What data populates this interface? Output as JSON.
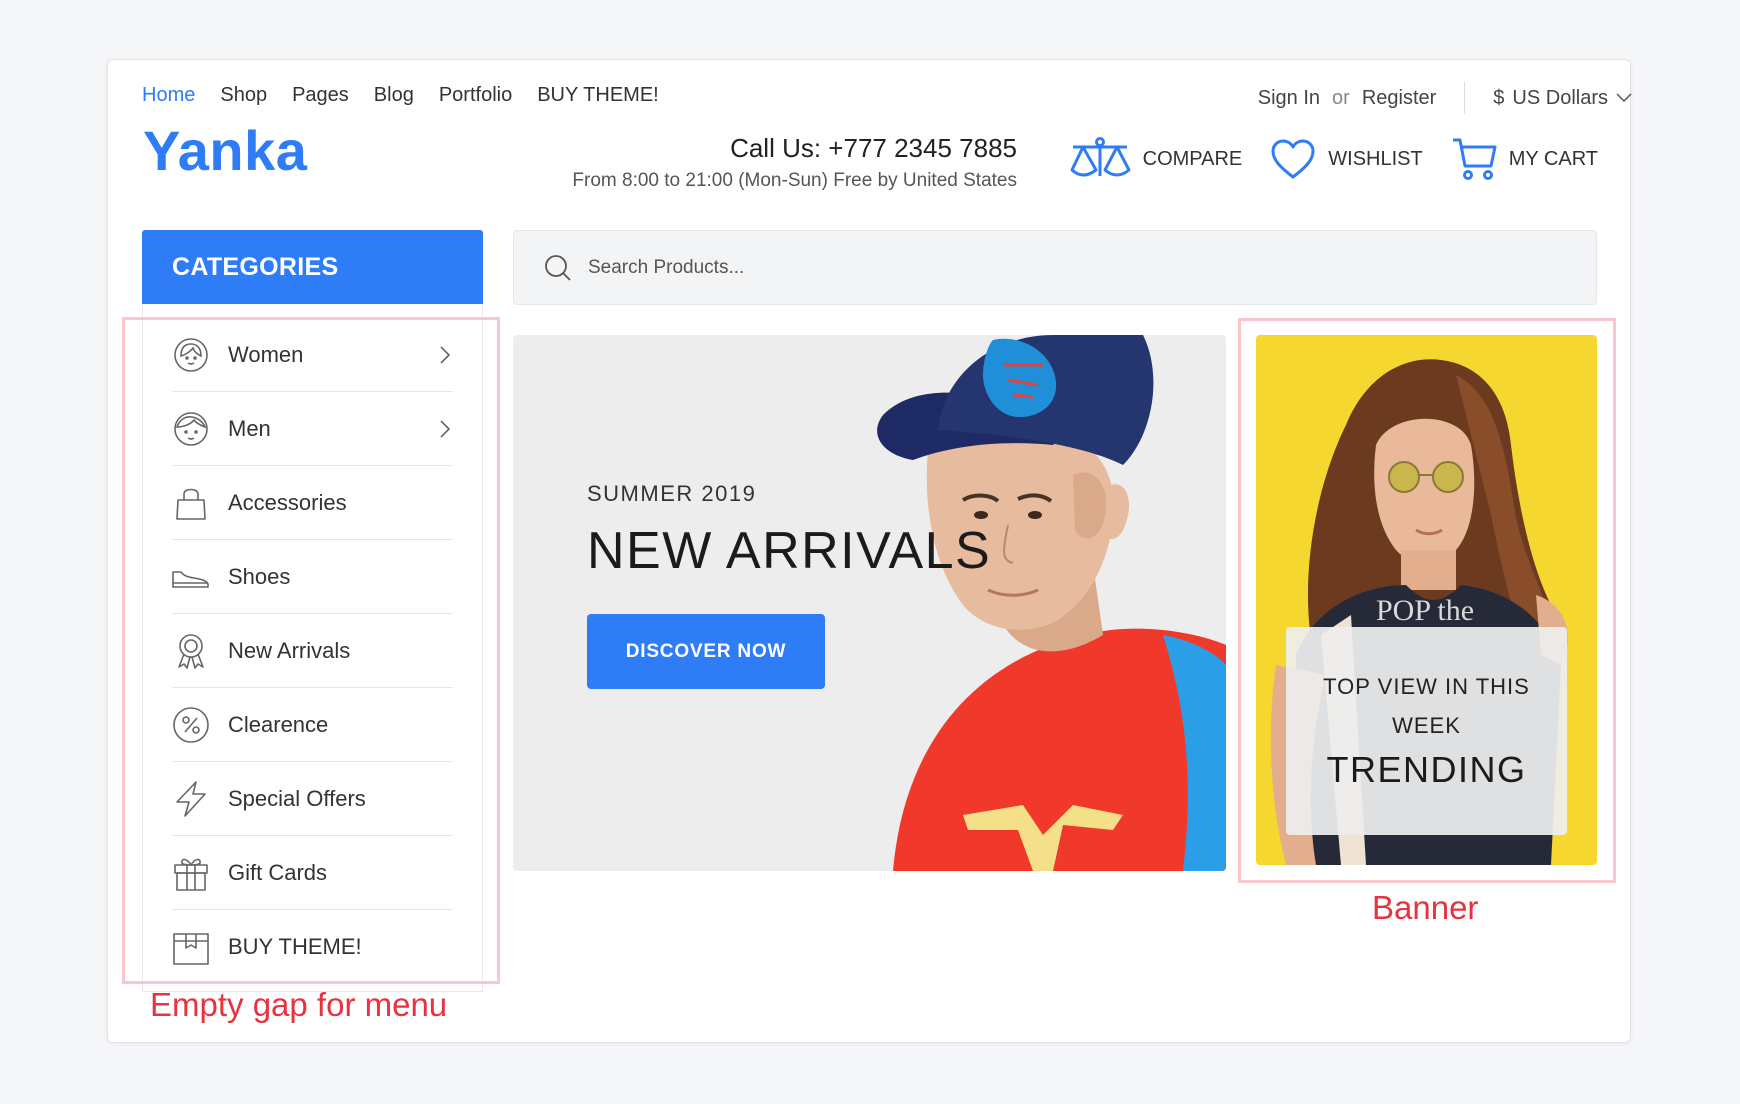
{
  "nav": {
    "items": [
      {
        "label": "Home",
        "active": true
      },
      {
        "label": "Shop"
      },
      {
        "label": "Pages"
      },
      {
        "label": "Blog"
      },
      {
        "label": "Portfolio"
      },
      {
        "label": "BUY THEME!"
      }
    ]
  },
  "account": {
    "sign_in": "Sign In",
    "or": "or",
    "register": "Register",
    "currency_symbol": "$",
    "currency": "US Dollars"
  },
  "brand": {
    "logo": "Yanka",
    "color": "#2e7cf6"
  },
  "contact": {
    "phone": "Call Us: +777 2345 7885",
    "hours": "From 8:00 to 21:00 (Mon-Sun) Free by United States"
  },
  "header_actions": {
    "compare": "COMPARE",
    "wishlist": "WISHLIST",
    "cart": "MY CART"
  },
  "categories": {
    "title": "CATEGORIES",
    "items": [
      {
        "label": "Women",
        "icon": "woman-face-icon",
        "has_submenu": true
      },
      {
        "label": "Men",
        "icon": "man-face-icon",
        "has_submenu": true
      },
      {
        "label": "Accessories",
        "icon": "bag-icon",
        "has_submenu": false
      },
      {
        "label": "Shoes",
        "icon": "shoe-icon",
        "has_submenu": false
      },
      {
        "label": "New Arrivals",
        "icon": "ribbon-badge-icon",
        "has_submenu": false
      },
      {
        "label": "Clearence",
        "icon": "percent-icon",
        "has_submenu": false
      },
      {
        "label": "Special Offers",
        "icon": "lightning-icon",
        "has_submenu": false
      },
      {
        "label": "Gift Cards",
        "icon": "gift-icon",
        "has_submenu": false
      },
      {
        "label": "BUY THEME!",
        "icon": "box-icon",
        "has_submenu": false
      }
    ]
  },
  "search": {
    "placeholder": "Search Products..."
  },
  "hero": {
    "kicker": "SUMMER 2019",
    "title": "NEW ARRIVALS",
    "cta": "DISCOVER NOW"
  },
  "banner": {
    "subtitle": "TOP VIEW IN THIS WEEK",
    "title": "TRENDING"
  },
  "annotations": {
    "menu_note": "Empty gap for menu",
    "banner_note": "Banner",
    "color": "#e8323f"
  }
}
